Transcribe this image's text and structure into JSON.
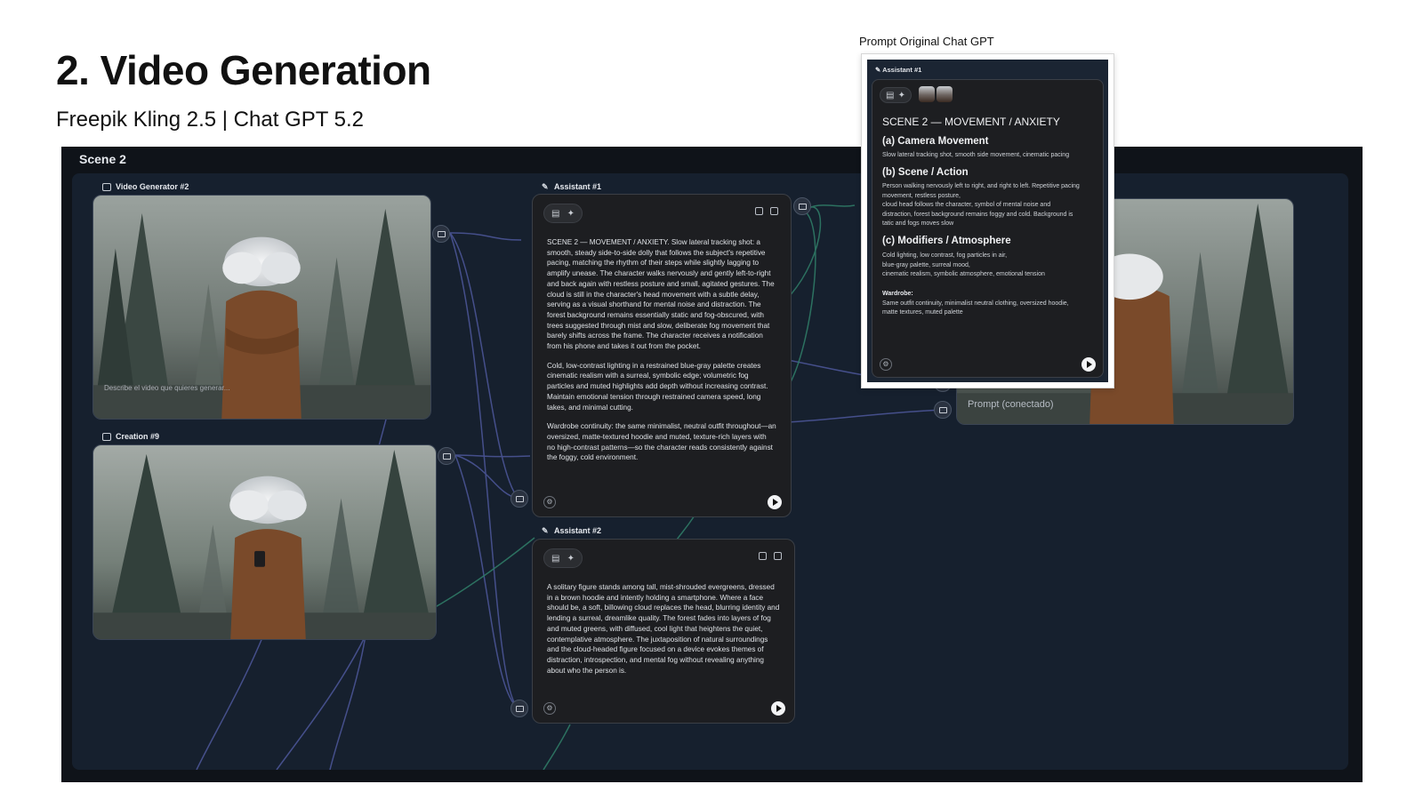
{
  "slide": {
    "title": "2. Video Generation",
    "subtitle": "Freepik Kling 2.5  | Chat GPT 5.2"
  },
  "board": {
    "title": "Scene 2"
  },
  "nodes": {
    "video_generator": {
      "label": "Video Generator #2",
      "placeholder": "Describe el video que quieres generar..."
    },
    "creation": {
      "label": "Creation #9"
    },
    "assistant1": {
      "label": "Assistant #1",
      "paragraphs": [
        "SCENE 2 — MOVEMENT / ANXIETY. Slow lateral tracking shot: a smooth, steady side-to-side dolly that follows the subject's repetitive pacing, matching the rhythm of their steps while slightly lagging to amplify unease. The character walks nervously and gently left-to-right and back again with restless posture and small, agitated gestures. The cloud is still in the character's head movement with a subtle delay, serving as a visual shorthand for mental noise and distraction. The forest background remains essentially static and fog-obscured, with trees suggested through mist and slow, deliberate fog movement that barely shifts across the frame. The character receives a notification from his phone and takes it out from the pocket.",
        "Cold, low-contrast lighting in a restrained blue-gray palette creates cinematic realism with a surreal, symbolic edge; volumetric fog particles and muted highlights add depth without increasing contrast. Maintain emotional tension through restrained camera speed, long takes, and minimal cutting.",
        "Wardrobe continuity: the same minimalist, neutral outfit throughout—an oversized, matte-textured hoodie and muted, texture-rich layers with no high-contrast patterns—so the character reads consistently against the foggy, cold environment."
      ]
    },
    "assistant2": {
      "label": "Assistant #2",
      "text": "A solitary figure stands among tall, mist-shrouded evergreens, dressed in a brown hoodie and intently holding a smartphone. Where a face should be, a soft, billowing cloud replaces the head, blurring identity and lending a surreal, dreamlike quality. The forest fades into layers of fog and muted greens, with diffused, cool light that heightens the quiet, contemplative atmosphere. The juxtaposition of natural surroundings and the cloud-headed figure focused on a device evokes themes of distraction, introspection, and mental fog without revealing anything about who the person is."
    },
    "output": {
      "hint": "Prompt (conectado)"
    }
  },
  "overlay": {
    "caption": "Prompt Original Chat GPT",
    "label": "Assistant #1",
    "heading": "SCENE 2 — MOVEMENT / ANXIETY",
    "sections": [
      {
        "title": "(a) Camera Movement",
        "lines": [
          "Slow lateral tracking shot, smooth side movement, cinematic pacing"
        ]
      },
      {
        "title": "(b) Scene / Action",
        "lines": [
          "Person walking nervously left to right, and right to left. Repetitive pacing",
          "movement, restless posture,",
          "cloud head follows the character, symbol of mental noise and",
          "distraction, forest background remains foggy and cold. Background is",
          "tatic and fogs moves slow"
        ]
      },
      {
        "title": "(c) Modifiers / Atmosphere",
        "lines": [
          "Cold lighting, low contrast, fog particles in air,",
          "blue-gray palette, surreal mood,",
          "cinematic realism, symbolic atmosphere, emotional tension"
        ]
      }
    ],
    "wardrobe_title": "Wardrobe:",
    "wardrobe_lines": [
      "Same outfit continuity, minimalist neutral clothing, oversized hoodie,",
      "matte textures, muted palette"
    ]
  },
  "colors": {
    "board_bg": "#0f1319",
    "canvas_bg": "#16202e",
    "card_bg": "#1d1e21",
    "wire_blue": "#4b5596",
    "wire_green": "#2f7a66",
    "hoodie": "#7a4a2a"
  }
}
